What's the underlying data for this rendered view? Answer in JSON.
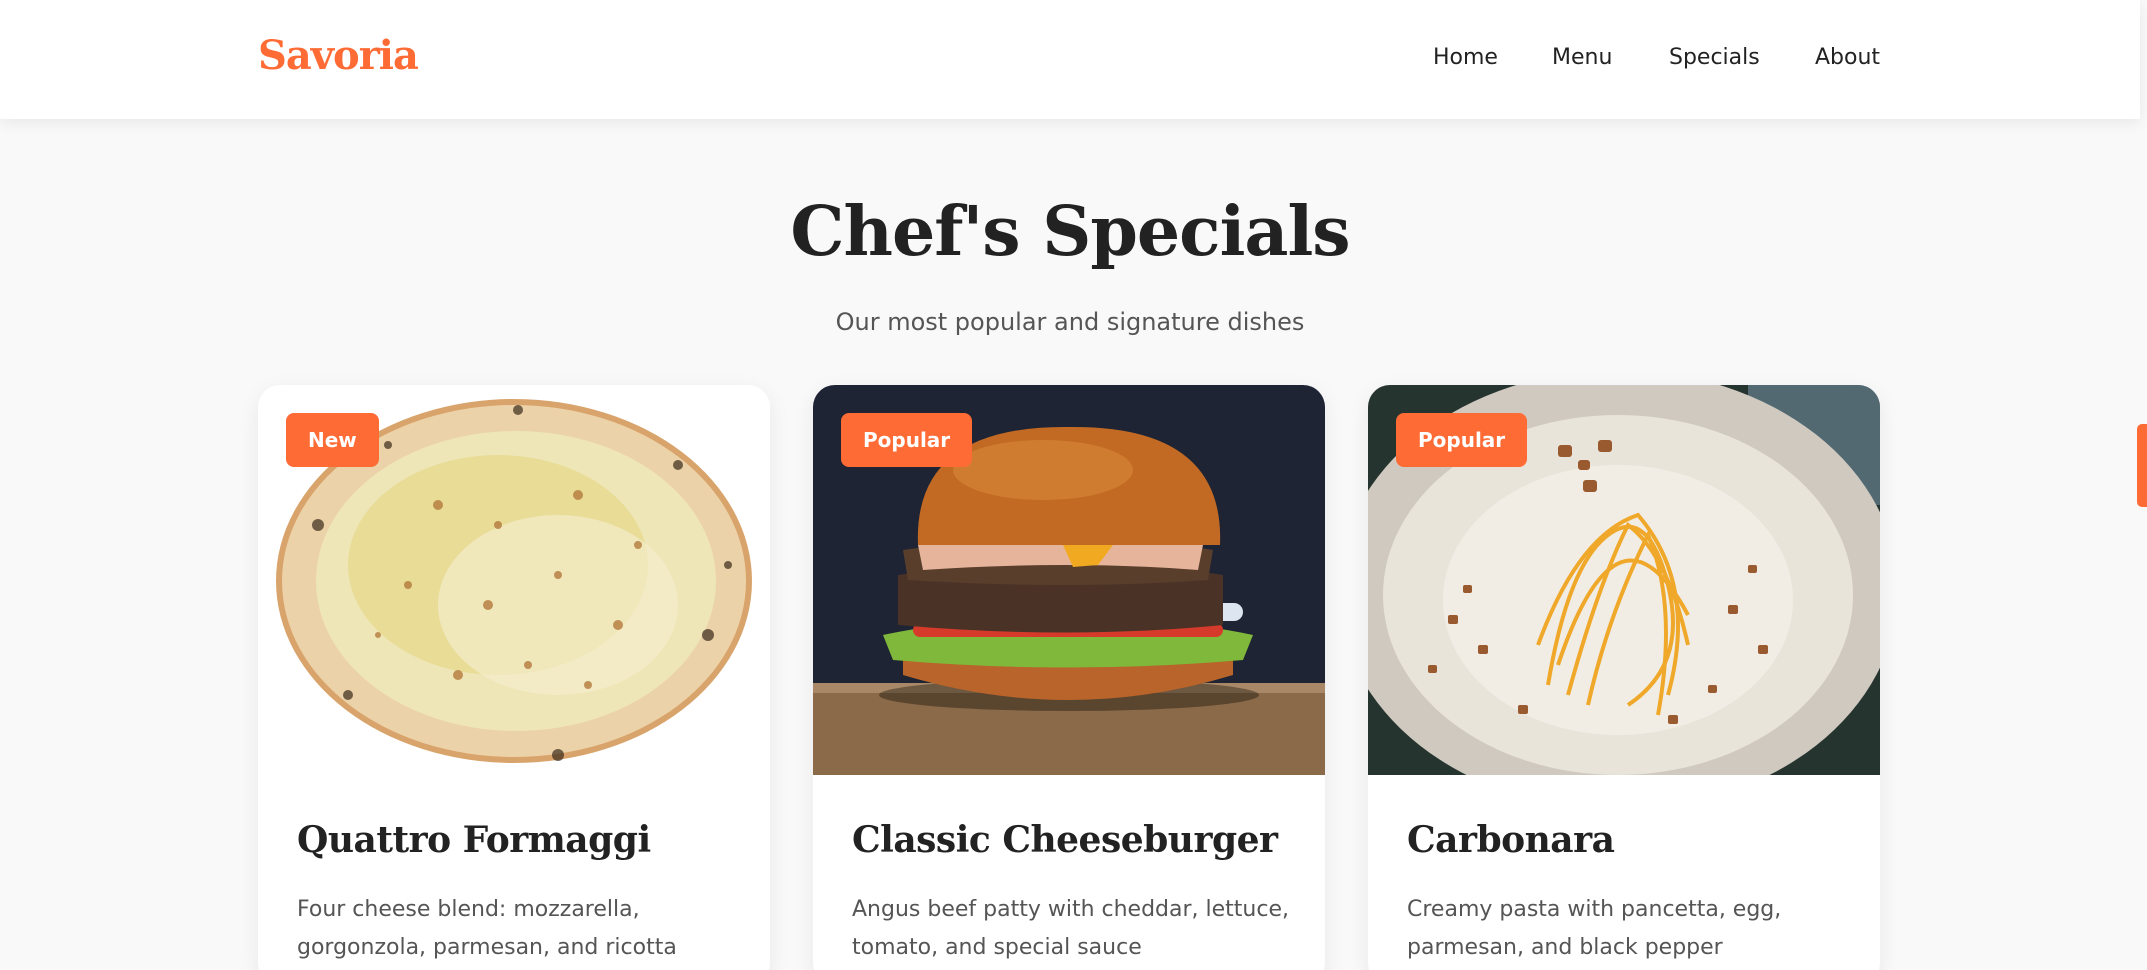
{
  "brand": {
    "name": "Savoria"
  },
  "nav": {
    "items": [
      {
        "label": "Home"
      },
      {
        "label": "Menu"
      },
      {
        "label": "Specials"
      },
      {
        "label": "About"
      }
    ]
  },
  "section": {
    "title": "Chef's Specials",
    "subtitle": "Our most popular and signature dishes"
  },
  "cards": [
    {
      "badge": "New",
      "title": "Quattro Formaggi",
      "description": "Four cheese blend: mozzarella, gorgonzola, parmesan, and ricotta",
      "image": "pizza"
    },
    {
      "badge": "Popular",
      "title": "Classic Cheeseburger",
      "description": "Angus beef patty with cheddar, lettuce, tomato, and special sauce",
      "image": "burger"
    },
    {
      "badge": "Popular",
      "title": "Carbonara",
      "description": "Creamy pasta with pancetta, egg, parmesan, and black pepper",
      "image": "pasta"
    }
  ],
  "colors": {
    "accent": "#ff6b35",
    "text": "#222222",
    "muted": "#555555",
    "background": "#f9f9fa"
  }
}
